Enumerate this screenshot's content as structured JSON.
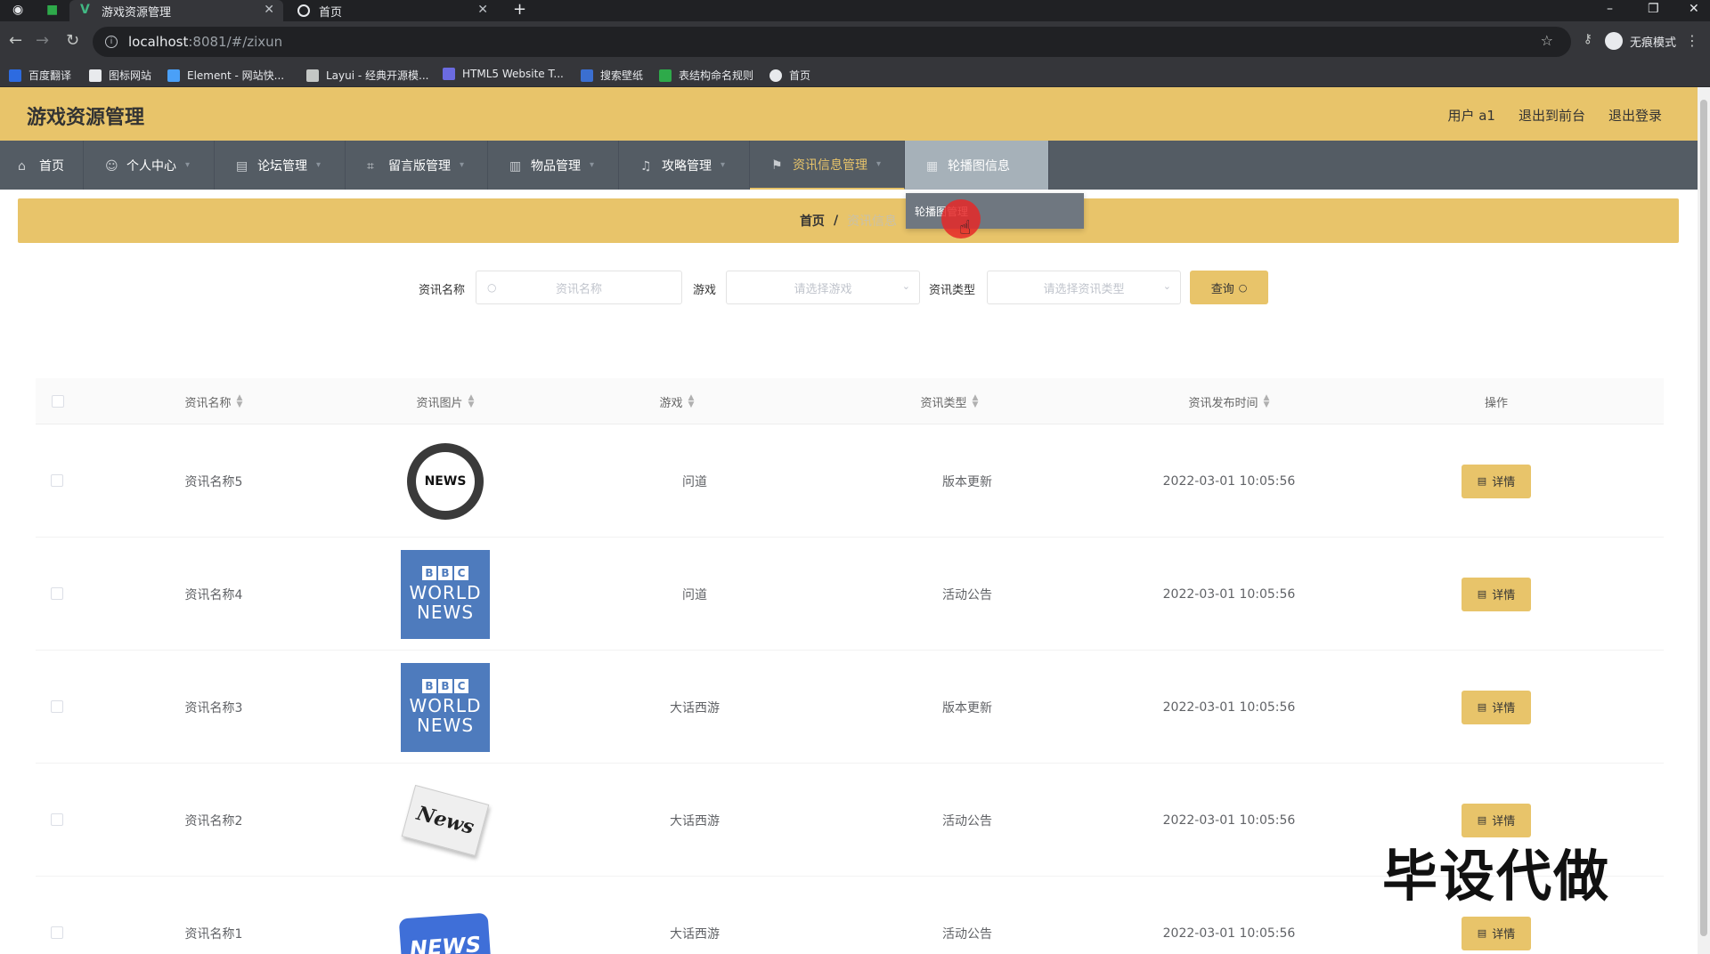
{
  "browser": {
    "tabs": [
      {
        "title": "游戏资源管理",
        "active": true
      },
      {
        "title": "首页",
        "active": false
      }
    ],
    "new_tab": "+",
    "url_host": "localhost",
    "url_path": ":8081/#/zixun",
    "incognito_label": "无痕模式",
    "bookmarks": [
      {
        "label": "百度翻译",
        "color": "#2d6be0"
      },
      {
        "label": "图标网站",
        "color": "#e8eaed"
      },
      {
        "label": "Element - 网站快...",
        "color": "#4aa0f8"
      },
      {
        "label": "Layui - 经典开源模...",
        "color": "#c4c7c5"
      },
      {
        "label": "HTML5 Website T...",
        "color": "#6b6be0"
      },
      {
        "label": "搜索壁纸",
        "color": "#3b6fd1"
      },
      {
        "label": "表结构命名规则",
        "color": "#2eaa4a"
      },
      {
        "label": "首页",
        "color": "#e8eaed"
      }
    ]
  },
  "header": {
    "title": "游戏资源管理",
    "user": "用户 a1",
    "back_front": "退出到前台",
    "logout": "退出登录"
  },
  "nav": [
    {
      "label": "首页"
    },
    {
      "label": "个人中心"
    },
    {
      "label": "论坛管理"
    },
    {
      "label": "留言版管理"
    },
    {
      "label": "物品管理"
    },
    {
      "label": "攻略管理"
    },
    {
      "label": "资讯信息管理"
    },
    {
      "label": "轮播图信息"
    }
  ],
  "dropdown": {
    "item": "轮播图管理"
  },
  "breadcrumb": {
    "home": "首页",
    "sep": "/",
    "current": "资讯信息"
  },
  "search": {
    "name_label": "资讯名称",
    "name_placeholder": "资讯名称",
    "game_label": "游戏",
    "game_placeholder": "请选择游戏",
    "type_label": "资讯类型",
    "type_placeholder": "请选择资讯类型",
    "query_label": "查询"
  },
  "table": {
    "headers": [
      "资讯名称",
      "资讯图片",
      "游戏",
      "资讯类型",
      "资讯发布时间",
      "操作"
    ],
    "detail_label": "详情",
    "rows": [
      {
        "name": "资讯名称5",
        "image": "news-globe",
        "game": "问道",
        "type": "版本更新",
        "time": "2022-03-01 10:05:56"
      },
      {
        "name": "资讯名称4",
        "image": "bbc",
        "game": "问道",
        "type": "活动公告",
        "time": "2022-03-01 10:05:56"
      },
      {
        "name": "资讯名称3",
        "image": "bbc",
        "game": "大话西游",
        "type": "版本更新",
        "time": "2022-03-01 10:05:56"
      },
      {
        "name": "资讯名称2",
        "image": "paper",
        "game": "大话西游",
        "type": "活动公告",
        "time": "2022-03-01 10:05:56"
      },
      {
        "name": "资讯名称1",
        "image": "news-sign",
        "game": "大话西游",
        "type": "活动公告",
        "time": "2022-03-01 10:05:56"
      }
    ]
  },
  "image_text": {
    "news": "NEWS",
    "bbc_letters": [
      "B",
      "B",
      "C"
    ],
    "world": "WORLD",
    "news_small": "NEWS",
    "paper": "News"
  },
  "watermark": "毕设代做",
  "colors": {
    "accent": "#e8c46a",
    "nav_bg": "#545c64"
  }
}
